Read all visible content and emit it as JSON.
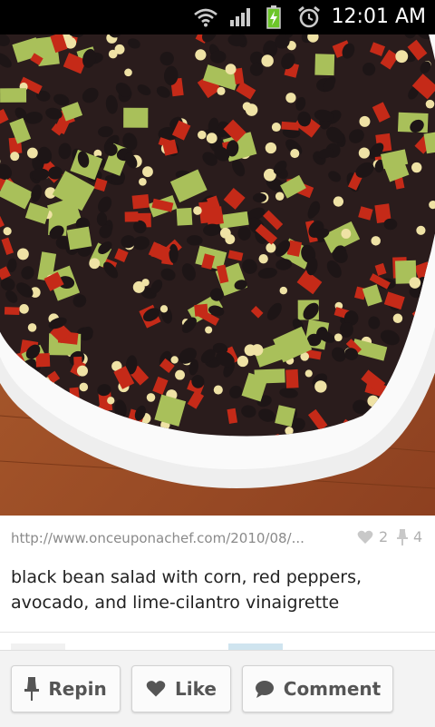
{
  "status_bar": {
    "time": "12:01 AM",
    "icons": [
      "wifi-icon",
      "signal-icon",
      "battery-charging-icon",
      "alarm-icon"
    ]
  },
  "photo": {
    "subject": "black bean salad photo",
    "colors": {
      "bean": "#1d1516",
      "pepper": "#c52a18",
      "corn": "#efe2a5",
      "avocado": "#a9c05a",
      "dish": "#f7f7f7",
      "table": "#a5522a"
    }
  },
  "pin": {
    "source_link": "http://www.onceuponachef.com/2010/08/...",
    "like_count": "2",
    "repin_count": "4",
    "description": "black bean salad with corn, red peppers, avocado, and lime-cilantro vinaigrette"
  },
  "actions": {
    "repin_label": "Repin",
    "like_label": "Like",
    "comment_label": "Comment"
  }
}
